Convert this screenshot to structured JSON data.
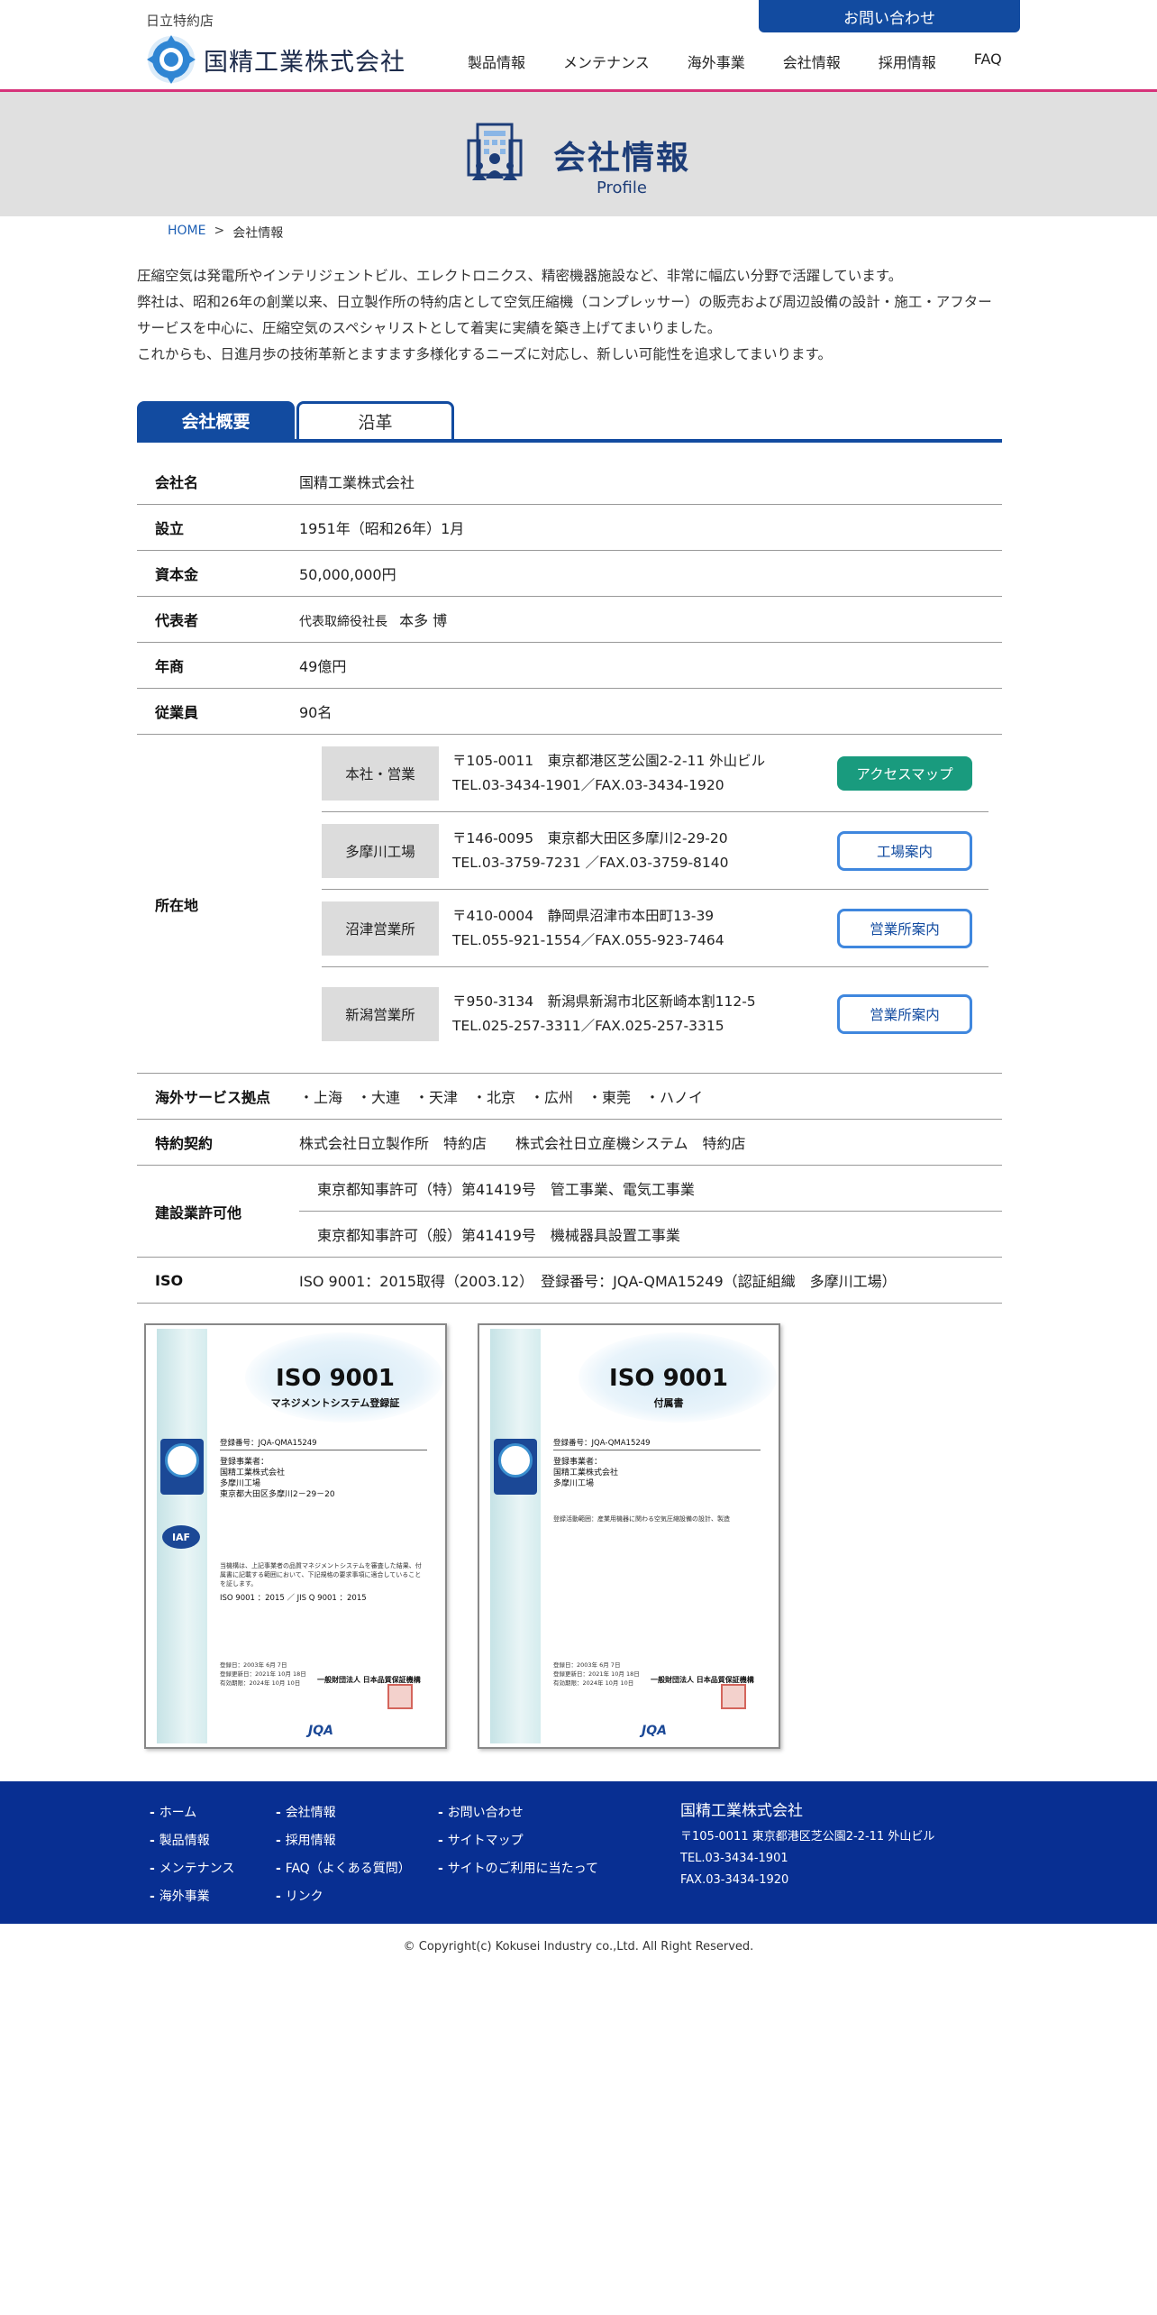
{
  "header": {
    "dealer_label": "日立特約店",
    "company_name": "国精工業株式会社",
    "contact_button": "お問い合わせ",
    "nav": [
      "製品情報",
      "メンテナンス",
      "海外事業",
      "会社情報",
      "採用情報",
      "FAQ"
    ]
  },
  "banner": {
    "title": "会社情報",
    "subtitle": "Profile",
    "icon": "building-people-icon"
  },
  "breadcrumb": {
    "home": "HOME",
    "separator": ">",
    "current": "会社情報"
  },
  "intro": [
    "圧縮空気は発電所やインテリジェントビル、エレクトロニクス、精密機器施設など、非常に幅広い分野で活躍しています。",
    "弊社は、昭和26年の創業以来、日立製作所の特約店として空気圧縮機（コンプレッサー）の販売および周辺設備の設計・施工・アフターサービスを中心に、圧縮空気のスペシャリストとして着実に実績を築き上げてまいりました。",
    "これからも、日進月歩の技術革新とますます多様化するニーズに対応し、新しい可能性を追求してまいります。"
  ],
  "tabs": {
    "overview": "会社概要",
    "history": "沿革"
  },
  "company": {
    "name": {
      "label": "会社名",
      "value": "国精工業株式会社"
    },
    "founded": {
      "label": "設立",
      "value": "1951年（昭和26年）1月"
    },
    "capital": {
      "label": "資本金",
      "value": "50,000,000円"
    },
    "representative": {
      "label": "代表者",
      "title": "代表取締役社長",
      "value": "本多 博"
    },
    "sales": {
      "label": "年商",
      "value": "49億円"
    },
    "employees": {
      "label": "従業員",
      "value": "90名"
    },
    "locations": {
      "label": "所在地",
      "items": [
        {
          "name": "本社・営業",
          "address": "〒105-0011　東京都港区芝公園2-2-11 外山ビル",
          "tel": "TEL.03-3434-1901／FAX.03-3434-1920",
          "button": "アクセスマップ"
        },
        {
          "name": "多摩川工場",
          "address": "〒146-0095　東京都大田区多摩川2-29-20",
          "tel": "TEL.03-3759-7231 ／FAX.03-3759-8140",
          "button": "工場案内"
        },
        {
          "name": "沼津営業所",
          "address": "〒410-0004　静岡県沼津市本田町13-39",
          "tel": "TEL.055-921-1554／FAX.055-923-7464",
          "button": "営業所案内"
        },
        {
          "name": "新潟営業所",
          "address": "〒950-3134　新潟県新潟市北区新崎本割112-5",
          "tel": "TEL.025-257-3311／FAX.025-257-3315",
          "button": "営業所案内"
        }
      ]
    },
    "overseas": {
      "label": "海外サービス拠点",
      "value": "・上海　・大連　・天津　・北京　・広州　・東莞　・ハノイ"
    },
    "agency": {
      "label": "特約契約",
      "value": "株式会社日立製作所　特約店　　株式会社日立産機システム　特約店"
    },
    "license": {
      "label": "建設業許可他",
      "items": [
        "東京都知事許可（特）第41419号　管工事業、電気工事業",
        "東京都知事許可（般）第41419号　機械器具設置工事業"
      ]
    },
    "iso": {
      "label": "ISO",
      "value": "ISO 9001：2015取得（2003.12）　登録番号：JQA-QMA15249（認証組織　多摩川工場）"
    }
  },
  "certificates": [
    {
      "title": "ISO 9001",
      "subtitle": "マネジメントシステム登録証",
      "reg_no": "登録番号：JQA-QMA15249",
      "holder_label": "登録事業者：",
      "holder": "国精工業株式会社",
      "site": "多摩川工場",
      "site_address": "東京都大田区多摩川2－29－20",
      "body": "当機構は、上記事業者の品質マネジメントシステムを審査した結果、付属書に記載する範囲において、下記規格の要求事項に適合していることを証します。",
      "standard": "ISO 9001 ：2015 ／ JIS Q 9001 ：2015",
      "dates": [
        "登録日：2003年 6月 7日",
        "登録更新日：2021年 10月 18日",
        "有効期限：2024年 10月 10日"
      ],
      "issuer": "一般財団法人 日本品質保証機構",
      "logo": "JQA"
    },
    {
      "title": "ISO 9001",
      "subtitle": "付属書",
      "reg_no": "登録番号：JQA-QMA15249",
      "holder_label": "登録事業者：",
      "holder": "国精工業株式会社",
      "site": "多摩川工場",
      "site_address": "",
      "body": "登録活動範囲：産業用機器に関わる空気圧縮設備の設計、製造",
      "standard": "",
      "dates": [
        "登録日：2003年 6月 7日",
        "登録更新日：2021年 10月 18日",
        "有効期限：2024年 10月 10日"
      ],
      "issuer": "一般財団法人 日本品質保証機構",
      "logo": "JQA"
    }
  ],
  "footer": {
    "col1": [
      "ホーム",
      "製品情報",
      "メンテナンス",
      "海外事業"
    ],
    "col2": [
      "会社情報",
      "採用情報",
      "FAQ（よくある質問）",
      "リンク"
    ],
    "col3": [
      "お問い合わせ",
      "サイトマップ",
      "サイトのご利用に当たって"
    ],
    "company": "国精工業株式会社",
    "address": "〒105-0011 東京都港区芝公園2-2-11 外山ビル",
    "tel": "TEL.03-3434-1901",
    "fax": "FAX.03-3434-1920",
    "copyright": "© Copyright(c) Kokusei Industry co.,Ltd. All Right Reserved."
  },
  "colors": {
    "brand_blue": "#124ba0",
    "accent_pink": "#d6337a",
    "button_green": "#199b7e",
    "footer_blue": "#082f92"
  }
}
